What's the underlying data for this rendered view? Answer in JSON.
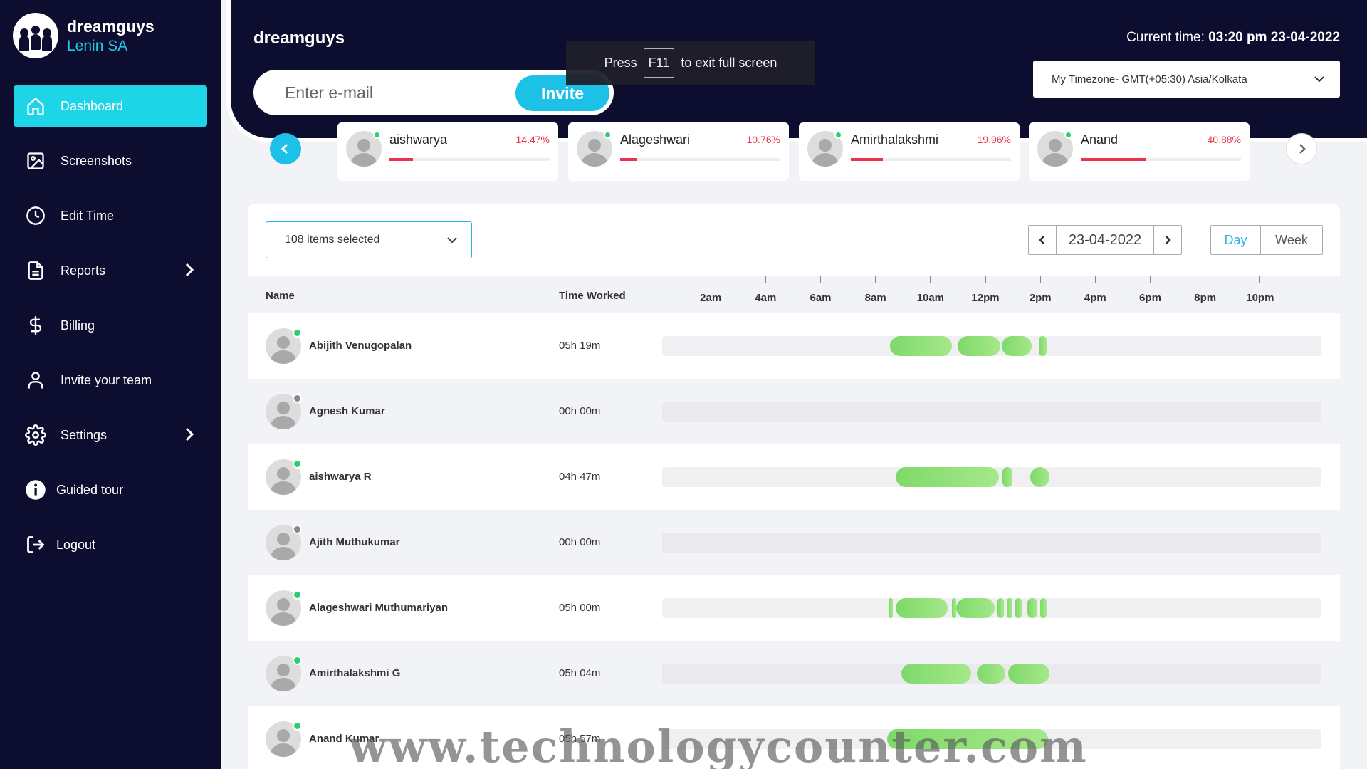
{
  "brand": {
    "name": "dreamguys",
    "user": "Lenin SA"
  },
  "sidebar": {
    "items": [
      {
        "label": "Dashboard",
        "icon": "home-icon"
      },
      {
        "label": "Screenshots",
        "icon": "image-icon"
      },
      {
        "label": "Edit Time",
        "icon": "clock-icon"
      },
      {
        "label": "Reports",
        "icon": "document-icon"
      },
      {
        "label": "Billing",
        "icon": "dollar-icon"
      },
      {
        "label": "Invite your team",
        "icon": "user-icon"
      },
      {
        "label": "Settings",
        "icon": "gear-icon"
      },
      {
        "label": "Guided tour",
        "icon": "info-icon"
      },
      {
        "label": "Logout",
        "icon": "logout-icon"
      }
    ]
  },
  "header": {
    "title": "dreamguys",
    "email_placeholder": "Enter e-mail",
    "invite_label": "Invite",
    "toast_press": "Press",
    "toast_key": "F11",
    "toast_rest": "to exit full screen",
    "current_time_label": "Current time: ",
    "current_time_value": "03:20 pm 23-04-2022",
    "timezone": "My Timezone- GMT(+05:30) Asia/Kolkata"
  },
  "user_cards": [
    {
      "name": "aishwarya",
      "percent_label": "14.47%",
      "percent": 14.47,
      "online": true
    },
    {
      "name": "Alageshwari",
      "percent_label": "10.76%",
      "percent": 10.76,
      "online": true
    },
    {
      "name": "Amirthalakshmi",
      "percent_label": "19.96%",
      "percent": 19.96,
      "online": true
    },
    {
      "name": "Anand",
      "percent_label": "40.88%",
      "percent": 40.88,
      "online": true
    }
  ],
  "toolbar": {
    "items_selected": "108 items selected",
    "date": "23-04-2022",
    "day_label": "Day",
    "week_label": "Week"
  },
  "table": {
    "col_name": "Name",
    "col_time": "Time Worked",
    "hours": [
      "2am",
      "4am",
      "6am",
      "8am",
      "10am",
      "12pm",
      "2pm",
      "4pm",
      "6pm",
      "8pm",
      "10pm"
    ],
    "rows": [
      {
        "name": "Abijith Venugopalan",
        "time": "05h 19m",
        "online": true,
        "segments": [
          [
            9.5,
            11.75
          ],
          [
            11.95,
            13.5
          ],
          [
            13.55,
            14.65
          ],
          [
            14.9,
            15.2
          ]
        ]
      },
      {
        "name": "Agnesh Kumar",
        "time": "00h 00m",
        "online": false,
        "segments": []
      },
      {
        "name": "aishwarya R",
        "time": "04h 47m",
        "online": true,
        "segments": [
          [
            9.7,
            13.45
          ],
          [
            13.6,
            13.95
          ],
          [
            14.6,
            15.3
          ]
        ]
      },
      {
        "name": "Ajith Muthukumar",
        "time": "00h 00m",
        "online": false,
        "segments": []
      },
      {
        "name": "Alageshwari Muthumariyan",
        "time": "05h 00m",
        "online": true,
        "segments": [
          [
            9.45,
            9.6
          ],
          [
            9.7,
            11.6
          ],
          [
            11.75,
            11.85
          ],
          [
            11.9,
            13.3
          ],
          [
            13.4,
            13.65
          ],
          [
            13.75,
            13.95
          ],
          [
            14.05,
            14.3
          ],
          [
            14.5,
            14.85
          ],
          [
            14.95,
            15.2
          ]
        ]
      },
      {
        "name": "Amirthalakshmi G",
        "time": "05h 04m",
        "online": true,
        "segments": [
          [
            9.9,
            12.45
          ],
          [
            12.65,
            13.7
          ],
          [
            13.8,
            15.3
          ]
        ]
      },
      {
        "name": "Anand Kumar",
        "time": "05h 57m",
        "online": true,
        "segments": [
          [
            9.4,
            15.25
          ]
        ]
      }
    ]
  },
  "watermark": "www.technologycounter.com",
  "colors": {
    "accent": "#1dd5e6",
    "sidebar": "#0d0d2f",
    "online": "#2ecc71",
    "offline": "#888888",
    "percent": "#e8334a",
    "bar": "#8ee07a"
  }
}
